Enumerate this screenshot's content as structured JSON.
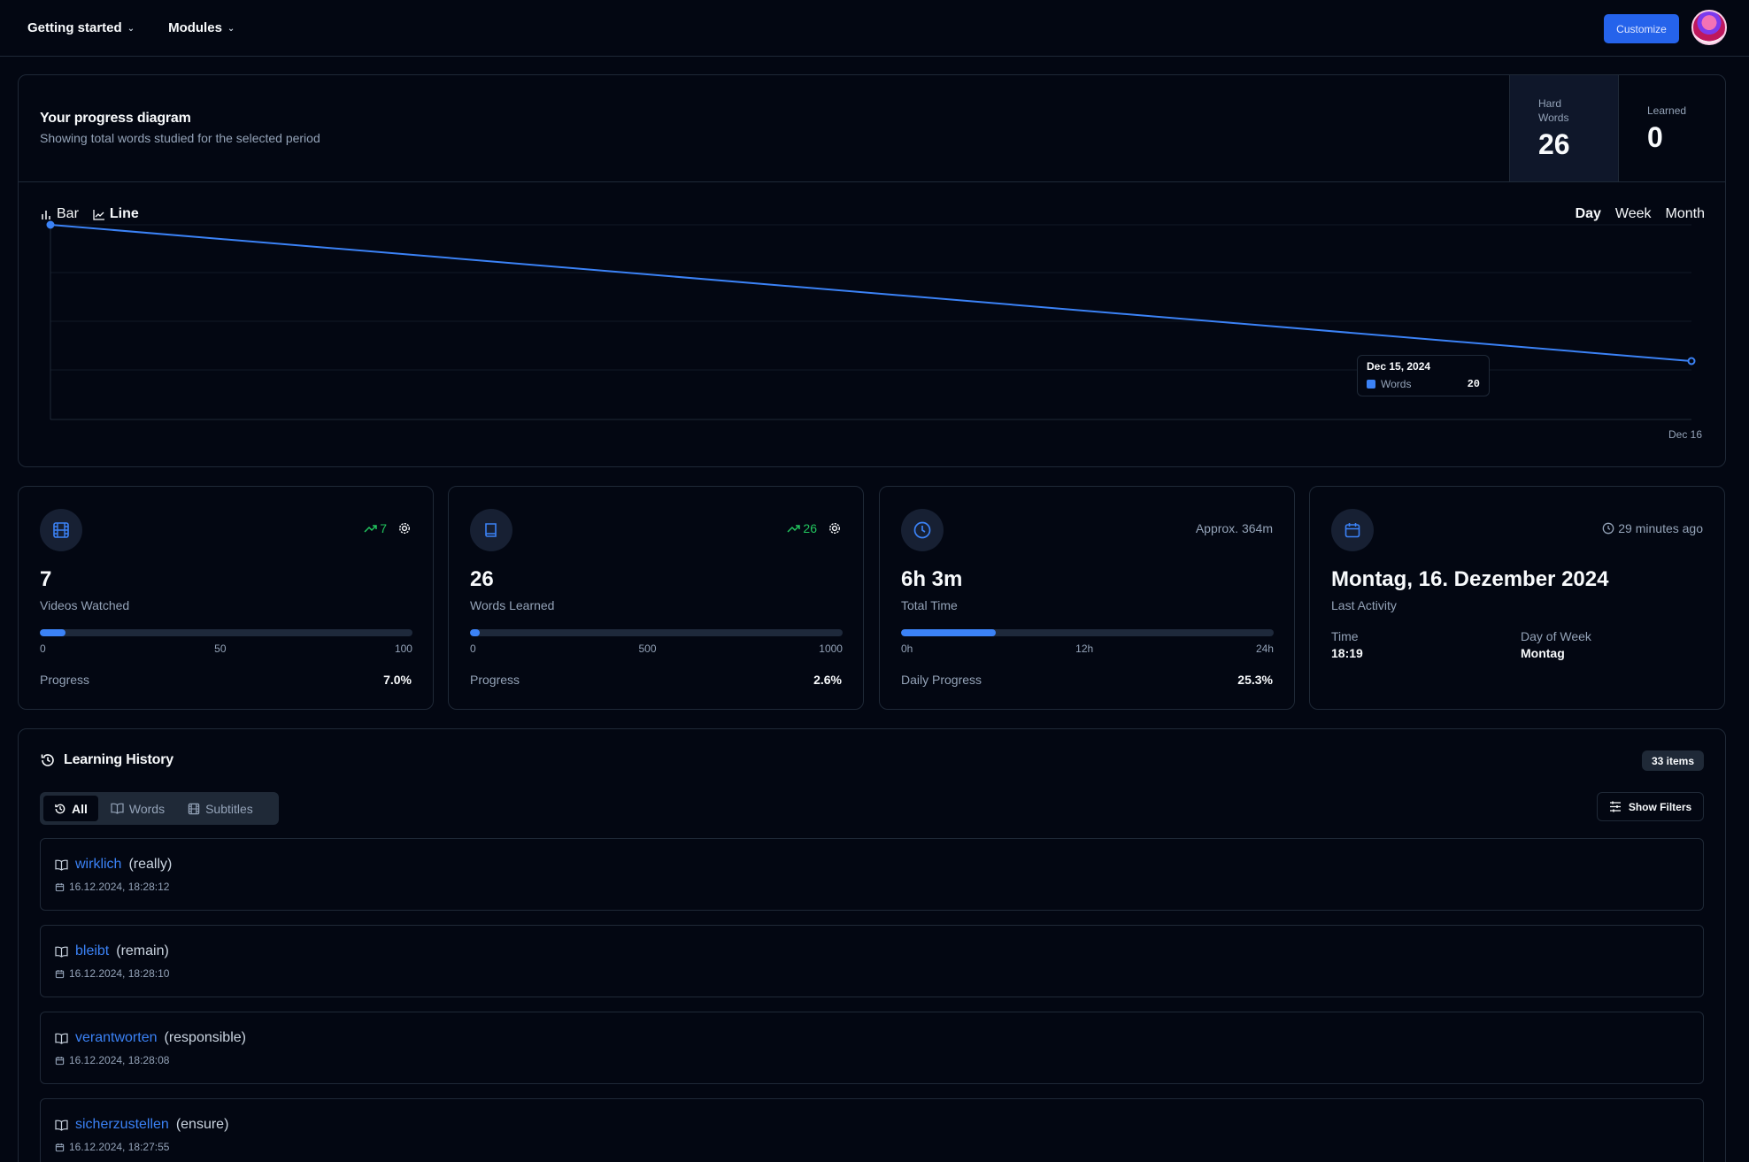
{
  "nav": {
    "getting_started": "Getting started",
    "modules": "Modules",
    "customize": "Customize"
  },
  "progress": {
    "title": "Your progress diagram",
    "subtitle": "Showing total words studied for the selected period",
    "hard_words_label": "Hard Words",
    "hard_words_value": "26",
    "learned_label": "Learned",
    "learned_value": "0",
    "chart_types": [
      "Bar",
      "Line"
    ],
    "active_chart_type": "Line",
    "periods": [
      "Day",
      "Week",
      "Month"
    ],
    "active_period": "Day"
  },
  "chart_data": {
    "type": "line",
    "x": [
      "Dec 15",
      "Dec 16"
    ],
    "series": [
      {
        "name": "Words",
        "values": [
          40,
          26
        ]
      }
    ],
    "tick_label": "Dec 16",
    "tooltip": {
      "date": "Dec 15, 2024",
      "series": "Words",
      "value": "20"
    },
    "grid": true,
    "color": "#3b82f6"
  },
  "cards": {
    "videos": {
      "trend": "7",
      "value": "7",
      "label": "Videos Watched",
      "ticks": [
        "0",
        "50",
        "100"
      ],
      "foot_label": "Progress",
      "foot_value": "7.0%",
      "progress": 0.07
    },
    "words": {
      "trend": "26",
      "value": "26",
      "label": "Words Learned",
      "ticks": [
        "0",
        "500",
        "1000"
      ],
      "foot_label": "Progress",
      "foot_value": "2.6%",
      "progress": 0.026
    },
    "time": {
      "approx": "Approx. 364m",
      "value": "6h 3m",
      "label": "Total Time",
      "ticks": [
        "0h",
        "12h",
        "24h"
      ],
      "foot_label": "Daily Progress",
      "foot_value": "25.3%",
      "progress": 0.253
    },
    "activity": {
      "ago": "29 minutes ago",
      "value": "Montag, 16. Dezember 2024",
      "label": "Last Activity",
      "time_label": "Time",
      "time_value": "18:19",
      "dow_label": "Day of Week",
      "dow_value": "Montag"
    }
  },
  "history": {
    "title": "Learning History",
    "count": "33 items",
    "tabs": [
      "All",
      "Words",
      "Subtitles"
    ],
    "show_filters": "Show Filters",
    "items": [
      {
        "word": "wirklich",
        "translation": "(really)",
        "date": "16.12.2024, 18:28:12"
      },
      {
        "word": "bleibt",
        "translation": "(remain)",
        "date": "16.12.2024, 18:28:10"
      },
      {
        "word": "verantworten",
        "translation": "(responsible)",
        "date": "16.12.2024, 18:28:08"
      },
      {
        "word": "sicherzustellen",
        "translation": "(ensure)",
        "date": "16.12.2024, 18:27:55"
      }
    ]
  },
  "colors": {
    "accent": "#3b82f6",
    "trend": "#22c55e",
    "background": "#030712",
    "border": "#1f2937"
  }
}
